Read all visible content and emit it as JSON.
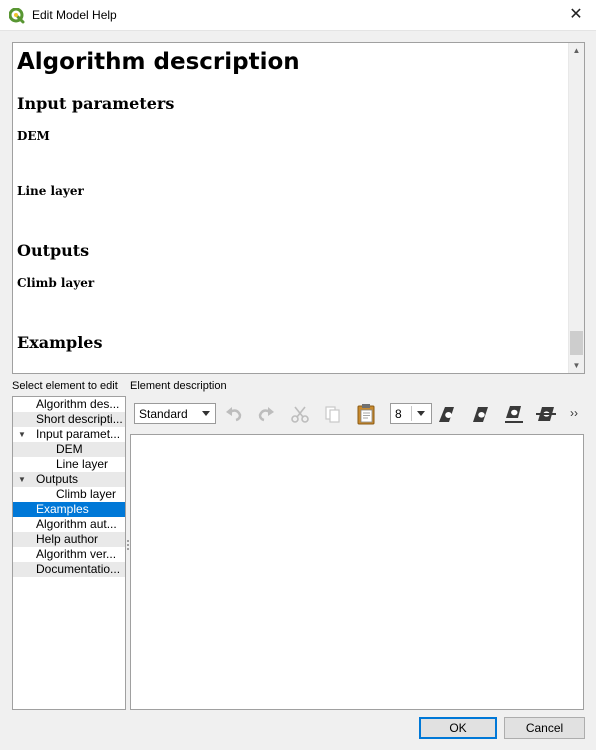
{
  "window": {
    "title": "Edit Model Help",
    "close_glyph": "✕"
  },
  "preview": {
    "heading": "Algorithm description",
    "sections": [
      {
        "title": "Input parameters"
      },
      {
        "title": "Outputs"
      },
      {
        "title": "Examples"
      }
    ],
    "parameters": [
      {
        "name": "DEM"
      },
      {
        "name": "Line layer"
      }
    ],
    "outputs": [
      {
        "name": "Climb layer"
      }
    ]
  },
  "left_panel": {
    "label": "Select element to edit",
    "items": [
      {
        "label": "Algorithm des...",
        "selected": false
      },
      {
        "label": "Short descripti...",
        "selected": false
      },
      {
        "label": "Input paramet...",
        "expanded": true,
        "selected": false
      },
      {
        "label": "DEM",
        "selected": false
      },
      {
        "label": "Line layer",
        "selected": false
      },
      {
        "label": "Outputs",
        "expanded": true,
        "selected": false
      },
      {
        "label": "Climb layer",
        "selected": false
      },
      {
        "label": "Examples",
        "selected": true
      },
      {
        "label": "Algorithm aut...",
        "selected": false
      },
      {
        "label": "Help author",
        "selected": false
      },
      {
        "label": "Algorithm ver...",
        "selected": false
      },
      {
        "label": "Documentatio...",
        "selected": false
      }
    ]
  },
  "right_panel": {
    "label": "Element description",
    "toolbar": {
      "style_value": "Standard",
      "font_size_value": "8",
      "more_glyph": "››",
      "icons": [
        "undo-icon",
        "redo-icon",
        "cut-icon",
        "copy-icon",
        "paste-icon",
        "bold-icon",
        "italic-icon",
        "underline-icon",
        "strikethrough-icon"
      ]
    },
    "editor_value": ""
  },
  "buttons": {
    "ok": "OK",
    "cancel": "Cancel"
  },
  "colors": {
    "selection": "#0078d7",
    "qgis_green": "#589632",
    "qgis_yellow": "#f0c52d"
  }
}
